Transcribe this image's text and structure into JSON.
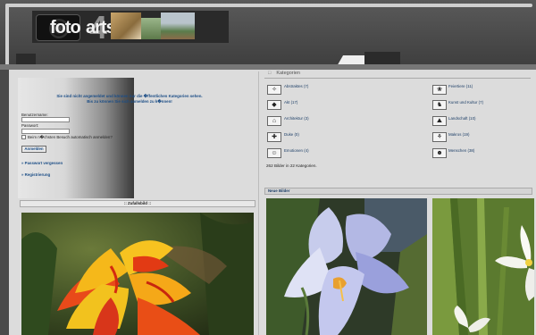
{
  "header": {
    "logo_text": "foto",
    "logo_number": "4",
    "logo_suffix": "arts"
  },
  "login": {
    "message_line1": "Sie sind nicht angemeldet und können nur die �ffentlichen Kategorien sehen.",
    "message_line2": "Bis zu können Sie sich anmelden zu k�nnen!",
    "username_label": "Benutzername:",
    "password_label": "Passwort:",
    "remember_label": "Beim n�chsten Besuch automatisch anmelden?",
    "login_button": "Anmelden",
    "forgot_password_link": "» Passwort vergessen",
    "register_link": "» Registrierung"
  },
  "categories": {
    "title": "Kategorien",
    "left": [
      {
        "label": "Abstraktes (7)",
        "icon": "✧"
      },
      {
        "label": "Akt (17)",
        "icon": "◆"
      },
      {
        "label": "Architektur (3)",
        "icon": "⌂"
      },
      {
        "label": "Duke (0)",
        "icon": "✚"
      },
      {
        "label": "Emotionen (4)",
        "icon": "☺"
      }
    ],
    "right": [
      {
        "label": "Feiertiere (11)",
        "icon": "❀"
      },
      {
        "label": "Kunst und Kultur (7)",
        "icon": "♞"
      },
      {
        "label": "Landschaft (10)",
        "icon": "⛰"
      },
      {
        "label": "Makros (19)",
        "icon": "⚘"
      },
      {
        "label": "Menschen (38)",
        "icon": "☻"
      }
    ],
    "total_text": "262 Bilder in 22 Kategorien."
  },
  "random_image": {
    "title": ":: Zufallsbild ::"
  },
  "new_images": {
    "title": "Neue Bilder"
  },
  "colors": {
    "link_blue": "#1b4d86",
    "background": "#4a4a4a",
    "panel": "#dcdcdc"
  }
}
